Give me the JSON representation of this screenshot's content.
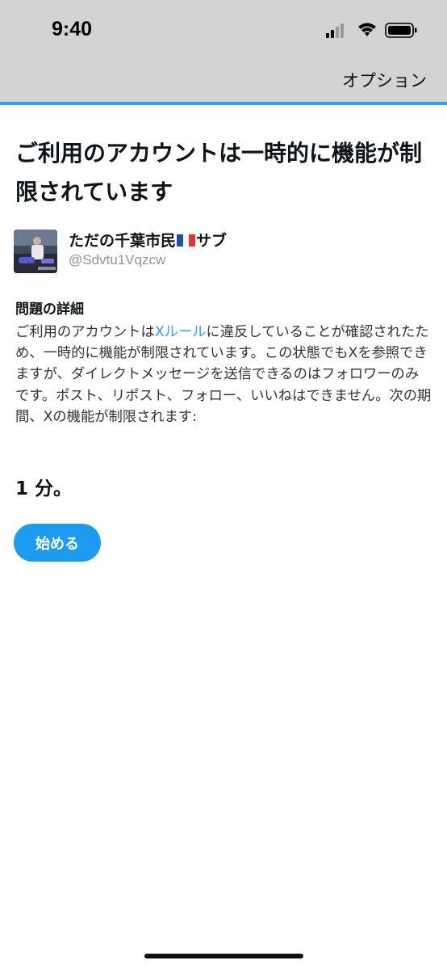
{
  "status_bar": {
    "time": "9:40",
    "icons": [
      "cellular-signal-icon",
      "wifi-icon",
      "battery-icon"
    ]
  },
  "header": {
    "options_label": "オプション"
  },
  "colors": {
    "header_bg": "#d3d3d3",
    "accent": "#3a9be8",
    "button": "#1d9bf0",
    "handle_gray": "#8c959e"
  },
  "main": {
    "title": "ご利用のアカウントは一時的に機能が制限されています",
    "account": {
      "display_name_prefix": "ただの千葉市民",
      "display_name_suffix": "サブ",
      "flag": "france-flag-icon",
      "handle": "@Sdvtu1Vqzcw"
    },
    "details_heading": "問題の詳細",
    "details_before_link": "ご利用のアカウントは",
    "details_link": "Xルール",
    "details_after_link": "に違反していることが確認されたため、一時的に機能が制限されています。この状態でもXを参照できますが、ダイレクトメッセージを送信できるのはフォロワーのみです。ポスト、リポスト、フォロー、いいねはできません。次の期間、Xの機能が制限されます:",
    "duration": "1 分。",
    "start_button_label": "始める"
  }
}
